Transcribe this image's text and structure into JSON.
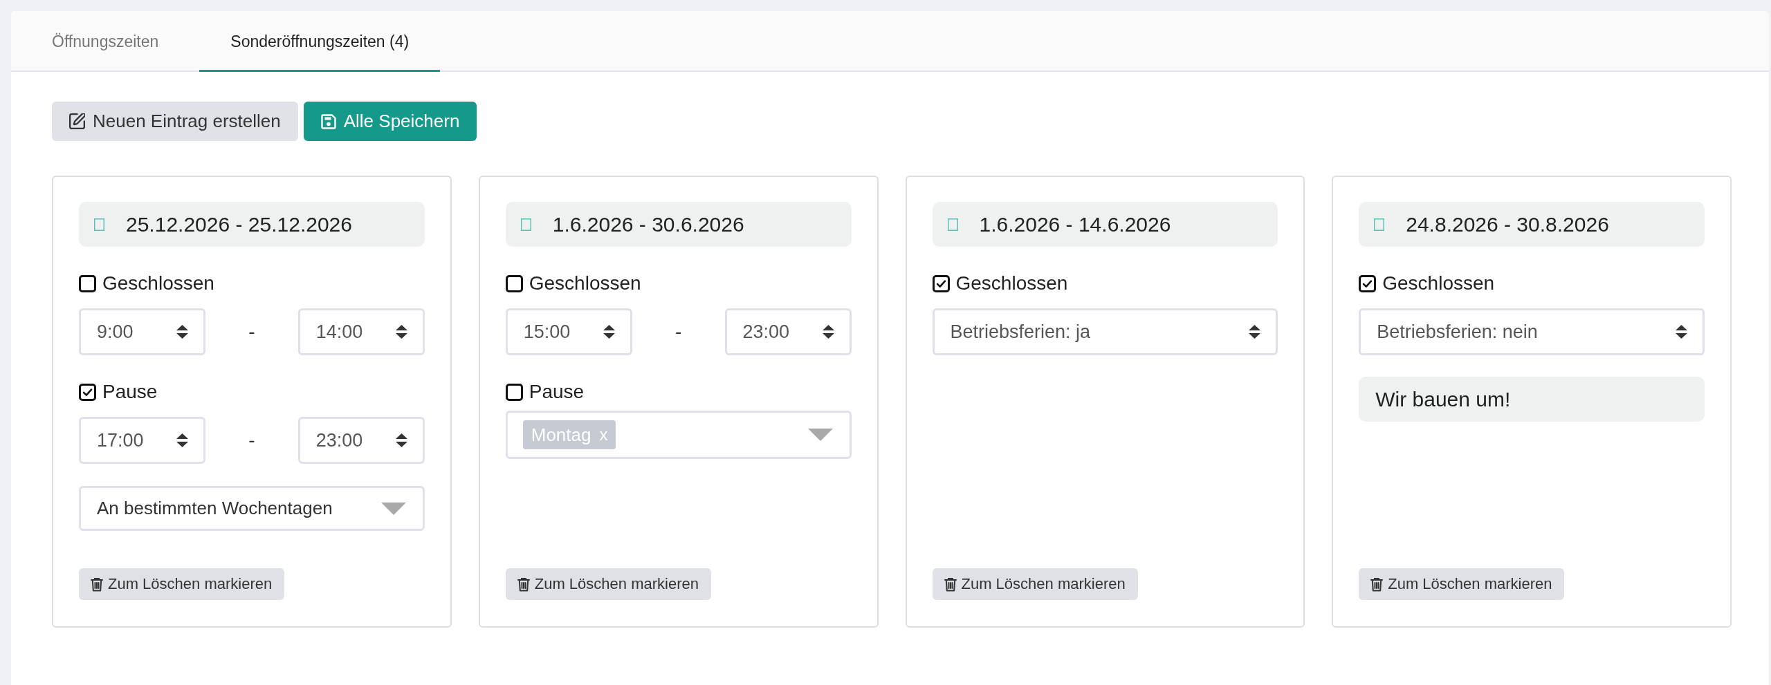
{
  "tabs": [
    {
      "label": "Öffnungszeiten",
      "selected": false
    },
    {
      "label": "Sonderöffnungszeiten (4)",
      "selected": true
    }
  ],
  "toolbar": [
    {
      "kind": "create",
      "label": "Neuen Eintrag erstellen"
    },
    {
      "kind": "save",
      "label": "Alle Speichern"
    }
  ],
  "entries": [
    {
      "date_range": "25.12.2026 - 25.12.2026",
      "fields": [
        {
          "kind": "checkbox",
          "label": "Geschlossen",
          "checked": false
        },
        {
          "kind": "time_range",
          "from": "9:00",
          "separator": "-",
          "to": "14:00"
        },
        {
          "kind": "checkbox",
          "label": "Pause",
          "checked": true
        },
        {
          "kind": "time_range",
          "from": "17:00",
          "separator": "-",
          "to": "23:00"
        },
        {
          "kind": "dropdown",
          "value": "An bestimmten Wochentagen"
        }
      ],
      "delete_button": "Zum Löschen markieren"
    },
    {
      "date_range": "1.6.2026 - 30.6.2026",
      "fields": [
        {
          "kind": "checkbox",
          "label": "Geschlossen",
          "checked": false
        },
        {
          "kind": "time_range",
          "from": "15:00",
          "separator": "-",
          "to": "23:00"
        },
        {
          "kind": "checkbox",
          "label": "Pause",
          "checked": false
        },
        {
          "kind": "tag_select",
          "tags": [
            {
              "label": "Montag",
              "remove": "x"
            }
          ]
        }
      ],
      "delete_button": "Zum Löschen markieren"
    },
    {
      "date_range": "1.6.2026 - 14.6.2026",
      "fields": [
        {
          "kind": "checkbox",
          "label": "Geschlossen",
          "checked": true
        },
        {
          "kind": "select",
          "value": "Betriebsferien: ja"
        }
      ],
      "delete_button": "Zum Löschen markieren"
    },
    {
      "date_range": "24.8.2026 - 30.8.2026",
      "fields": [
        {
          "kind": "checkbox",
          "label": "Geschlossen",
          "checked": true
        },
        {
          "kind": "select",
          "value": "Betriebsferien: nein"
        },
        {
          "kind": "text_field",
          "value": "Wir bauen um!"
        }
      ],
      "delete_button": "Zum Löschen markieren"
    }
  ]
}
